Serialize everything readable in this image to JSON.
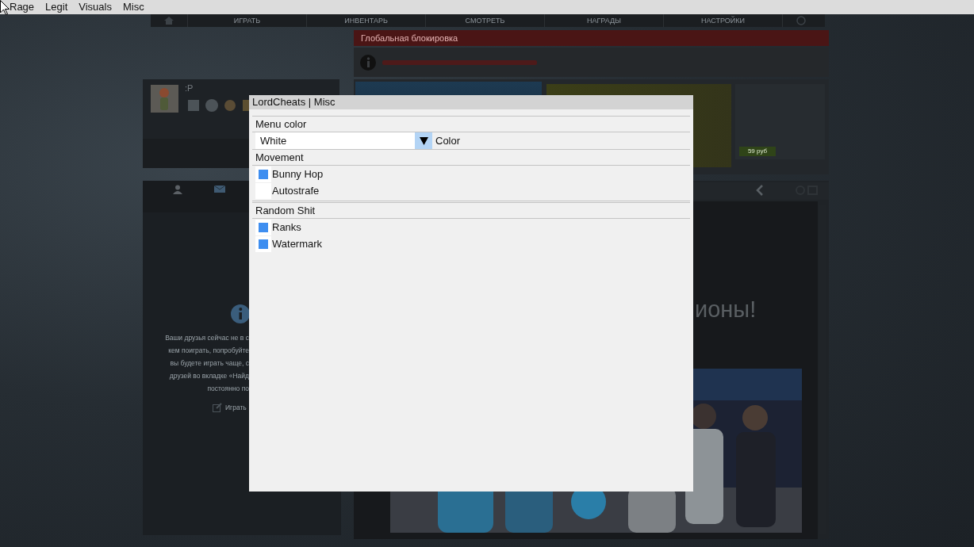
{
  "menu_bar": {
    "items": [
      {
        "label": "Rage"
      },
      {
        "label": "Legit"
      },
      {
        "label": "Visuals"
      },
      {
        "label": "Misc"
      }
    ]
  },
  "game": {
    "nav": [
      {
        "label": "ИГРАТЬ"
      },
      {
        "label": "ИНВЕНТАРЬ"
      },
      {
        "label": "СМОТРЕТЬ"
      },
      {
        "label": "НАГРАДЫ"
      },
      {
        "label": "НАСТРОЙКИ"
      }
    ],
    "banner": "Глобальная блокировка",
    "profile_name": ":P",
    "friends_lines": [
      "Ваши друзья сейчас не в с",
      "кем поиграть, попробуйте",
      "вы будете играть чаще, с",
      "друзей во вкладке «Найд",
      "постоянно по"
    ],
    "friends_link": "Играть",
    "headline": "ионы!",
    "store_price": "59 руб"
  },
  "window": {
    "title": "LordCheats | Misc",
    "sections": [
      {
        "title": "Menu color",
        "controls": [
          {
            "kind": "dropdown",
            "value": "White",
            "label": "Color"
          }
        ]
      },
      {
        "title": "Movement",
        "controls": [
          {
            "kind": "checkbox",
            "label": "Bunny Hop",
            "checked": true
          },
          {
            "kind": "checkbox",
            "label": "Autostrafe",
            "checked": false
          }
        ]
      },
      {
        "title": "Random Shit",
        "controls": [
          {
            "kind": "checkbox",
            "label": "Ranks",
            "checked": true
          },
          {
            "kind": "checkbox",
            "label": "Watermark",
            "checked": true
          }
        ]
      }
    ]
  }
}
